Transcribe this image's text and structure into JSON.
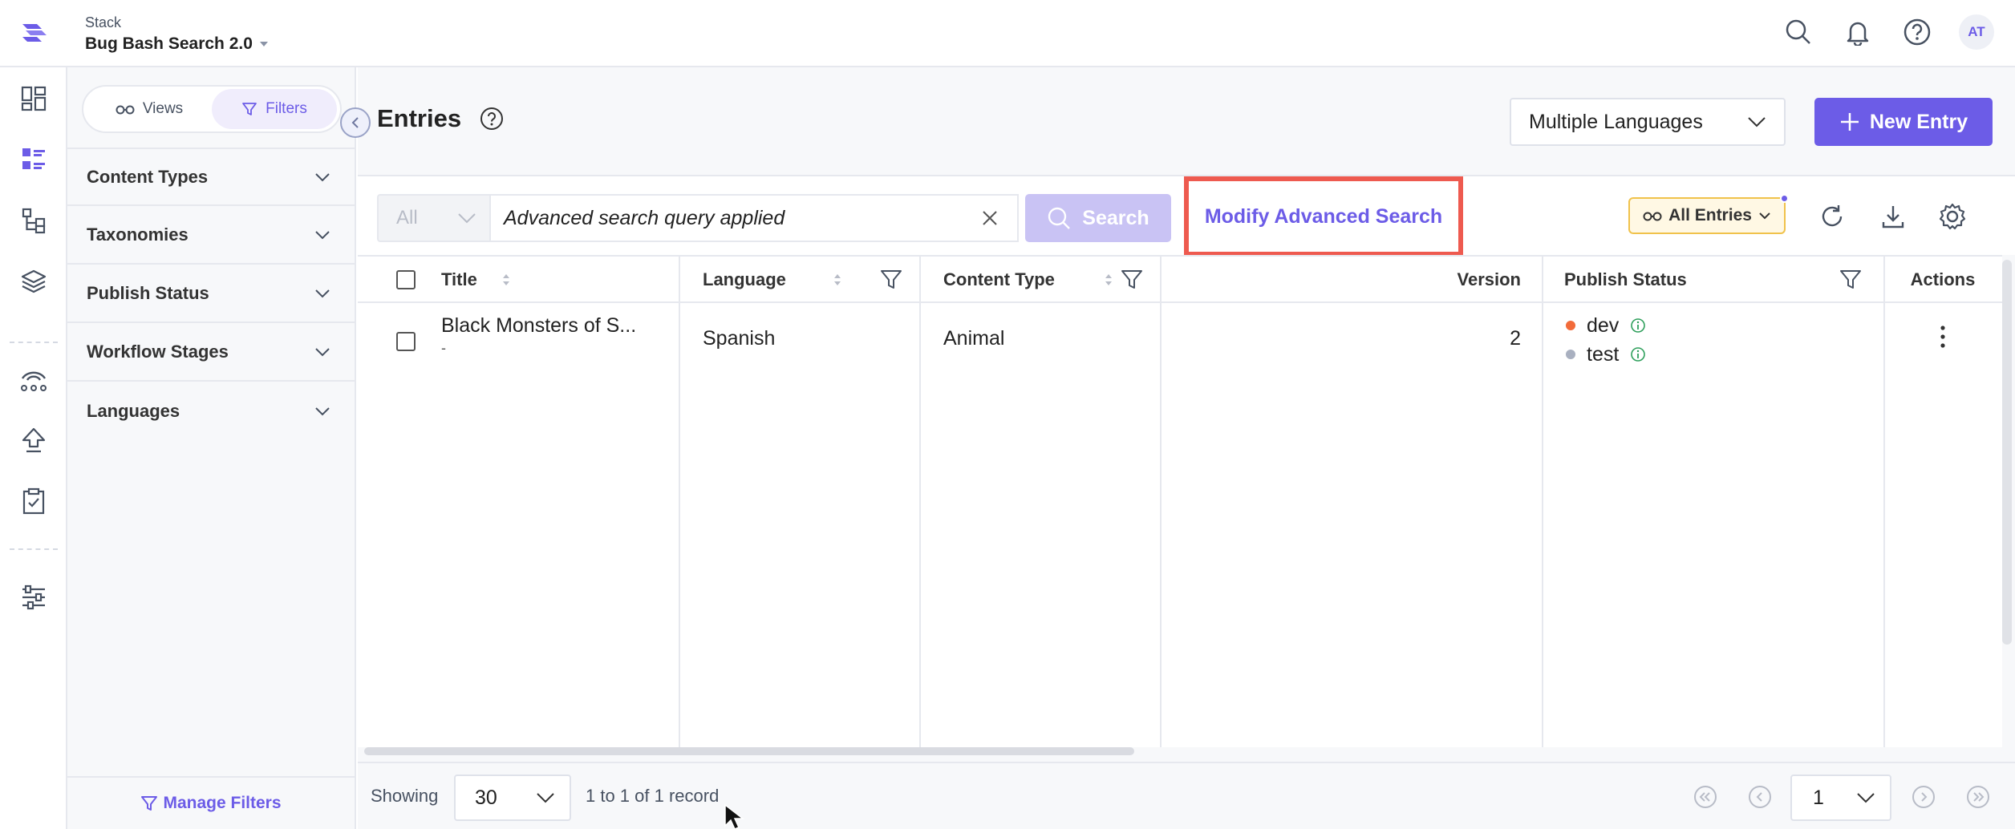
{
  "header": {
    "stack_label": "Stack",
    "stack_name": "Bug Bash Search 2.0",
    "icons": [
      "search-icon",
      "bell-icon",
      "help-icon"
    ],
    "avatar_initials": "AT"
  },
  "rail": {
    "items": [
      "dashboard-icon",
      "entries-icon",
      "content-models-icon",
      "assets-icon",
      "releases-icon",
      "deploy-icon",
      "tasks-icon",
      "settings-icon"
    ],
    "active": "entries-icon"
  },
  "sidebar": {
    "tabs": [
      {
        "label": "Views",
        "icon": "glasses-icon"
      },
      {
        "label": "Filters",
        "icon": "filter-icon",
        "active": true
      }
    ],
    "filters": [
      "Content Types",
      "Taxonomies",
      "Publish Status",
      "Workflow Stages",
      "Languages"
    ],
    "manage_label": "Manage Filters"
  },
  "main": {
    "title": "Entries",
    "language_select": "Multiple Languages",
    "new_entry_label": "New Entry"
  },
  "toolbar": {
    "scope_select": "All",
    "search_value": "Advanced search query applied",
    "search_button": "Search",
    "modify_label": "Modify Advanced Search",
    "all_entries_label": "All Entries"
  },
  "table": {
    "columns": [
      "Title",
      "Language",
      "Content Type",
      "Version",
      "Publish Status",
      "Actions"
    ],
    "rows": [
      {
        "title": "Black Monsters of S...",
        "subtitle": "-",
        "language": "Spanish",
        "content_type": "Animal",
        "version": "2",
        "publish": [
          {
            "env": "dev",
            "color": "#f26b3a"
          },
          {
            "env": "test",
            "color": "#a9b0c0"
          }
        ]
      }
    ]
  },
  "footer": {
    "showing_label": "Showing",
    "per_page": "30",
    "range_text": "1 to 1 of 1 record",
    "page": "1"
  },
  "colors": {
    "accent": "#6c5ce7",
    "highlight_box": "#ee5a4f"
  }
}
